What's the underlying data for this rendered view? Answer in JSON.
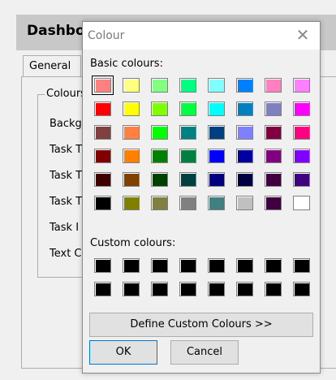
{
  "dashboard": {
    "title": "Dashbo",
    "tab_general": "General",
    "group_label": "Colours",
    "rows": [
      "Backg",
      "Task T",
      "Task T",
      "Task T",
      "Task I",
      "Text C"
    ]
  },
  "dialog": {
    "title": "Colour",
    "close_icon": "close-icon",
    "basic_label": "Basic colours:",
    "custom_label": "Custom colours:",
    "define_button": "Define Custom Colours >>",
    "ok_button": "OK",
    "cancel_button": "Cancel",
    "selected_swatch": 0,
    "basic_colours": [
      "#ff8080",
      "#ffff80",
      "#80ff80",
      "#00ff80",
      "#80ffff",
      "#0080ff",
      "#ff80c0",
      "#ff80ff",
      "#ff0000",
      "#ffff00",
      "#80ff00",
      "#00ff40",
      "#00ffff",
      "#0080c0",
      "#8080c0",
      "#ff00ff",
      "#804040",
      "#ff8040",
      "#00ff00",
      "#008080",
      "#004080",
      "#8080ff",
      "#800040",
      "#ff0080",
      "#800000",
      "#ff8000",
      "#008000",
      "#008040",
      "#0000ff",
      "#0000a0",
      "#800080",
      "#8000ff",
      "#400000",
      "#804000",
      "#004000",
      "#004040",
      "#000080",
      "#000040",
      "#400040",
      "#400080",
      "#000000",
      "#808000",
      "#808040",
      "#808080",
      "#408080",
      "#c0c0c0",
      "#400040",
      "#ffffff"
    ],
    "custom_colours": [
      "#000000",
      "#000000",
      "#000000",
      "#000000",
      "#000000",
      "#000000",
      "#000000",
      "#000000",
      "#000000",
      "#000000",
      "#000000",
      "#000000",
      "#000000",
      "#000000",
      "#000000",
      "#000000"
    ]
  }
}
